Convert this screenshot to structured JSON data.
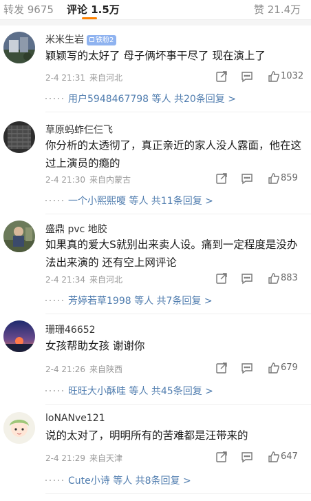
{
  "tabs": {
    "repost": "转发 9675",
    "comments": "评论 1.5万",
    "likes": "赞 21.4万"
  },
  "accent_color": "#ff8200",
  "comments": [
    {
      "name": "米米生岩",
      "badge": "铁粉2",
      "text": "颖颖写的太好了 母子俩坏事干尽了 现在演上了",
      "time": "2-4 21:31",
      "source": "来自河北",
      "likes": "1032",
      "replies": "用户5948467798 等人 共20条回复 >"
    },
    {
      "name": "草原蚂蚱仨仨飞",
      "text": "你分析的太透彻了，真正亲近的家人没人露面，他在这过上演员的瘾的",
      "time": "2-4 21:30",
      "source": "来自内蒙古",
      "likes": "859",
      "replies": "一个小熙熙嗄 等人 共11条回复 >"
    },
    {
      "name": "盛鼎 pvc 地胶",
      "text": "如果真的爱大S就别出来卖人设。痛到一定程度是没办法出来演的  还有空上网评论",
      "time": "2-4 21:34",
      "source": "来自河北",
      "likes": "883",
      "replies": "芳婷若草1998 等人 共7条回复 >"
    },
    {
      "name": "珊珊46652",
      "text": "女孩帮助女孩 谢谢你",
      "time": "2-4 21:26",
      "source": "来自陕西",
      "likes": "679",
      "replies": "旺旺大小酥哇 等人 共45条回复 >"
    },
    {
      "name": "loNANve121",
      "text": "说的太对了，明明所有的苦难都是汪带来的",
      "time": "2-4 21:29",
      "source": "来自天津",
      "likes": "647",
      "replies": "Cute小诗 等人 共8条回复 >"
    }
  ]
}
